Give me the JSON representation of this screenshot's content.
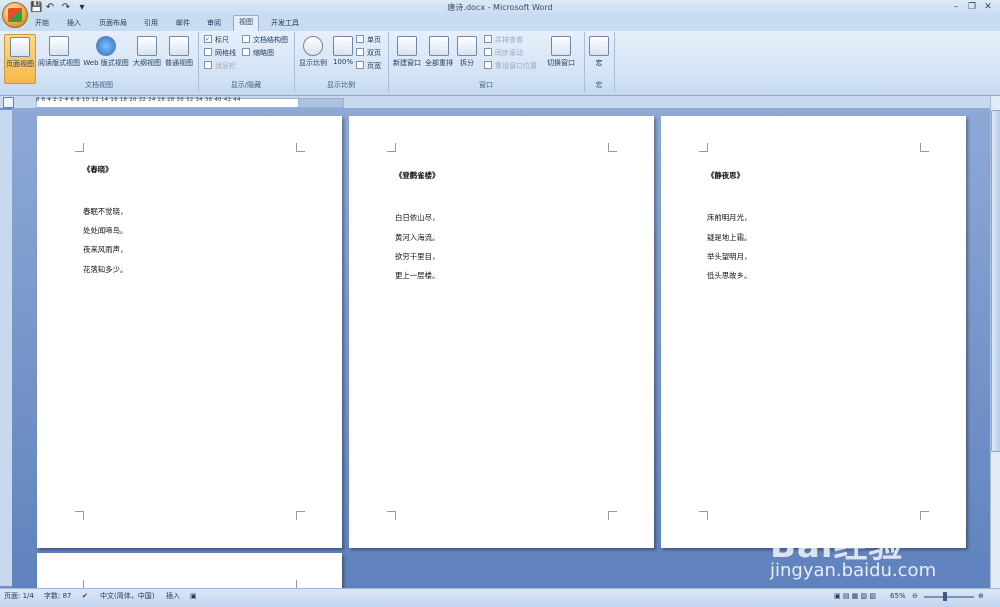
{
  "window": {
    "title": "唐诗.docx - Microsoft Word"
  },
  "tabs": [
    "开始",
    "插入",
    "页面布局",
    "引用",
    "邮件",
    "审阅",
    "视图",
    "开发工具"
  ],
  "active_tab": "视图",
  "ribbon": {
    "doc_views": {
      "label": "文档视图",
      "buttons": [
        "页面视图",
        "阅读版式视图",
        "Web 版式视图",
        "大纲视图",
        "普通视图"
      ],
      "selected": "页面视图"
    },
    "show_hide": {
      "label": "显示/隐藏",
      "ruler": "标尺",
      "gridlines": "网格线",
      "message_bar": "消息栏",
      "doc_map": "文档结构图",
      "thumbnails": "缩略图"
    },
    "zoom": {
      "label": "显示比例",
      "zoom_btn": "显示比例",
      "hundred": "100%",
      "one_page": "单页",
      "two_pages": "双页",
      "page_width": "页宽"
    },
    "window": {
      "label": "窗口",
      "new_window": "新建窗口",
      "arrange_all": "全部重排",
      "split": "拆分",
      "side_by_side": "并排查看",
      "sync_scroll": "同步滚动",
      "reset_position": "重设窗口位置",
      "switch_windows": "切换窗口"
    },
    "macros": {
      "label": "宏",
      "btn": "宏"
    }
  },
  "ruler_ticks": "8   6   4   2       2   4   6   8   10   12   14   16   18   20   22   24   26   28   30   32   34   36       40   42   44",
  "pages": [
    {
      "title": "《春晓》",
      "lines": [
        "春眠不觉晓，",
        "处处闻啼鸟。",
        " 夜来风雨声，",
        "花落知多少。"
      ]
    },
    {
      "title": "《登鹳雀楼》",
      "lines": [
        "白日依山尽，",
        "黄河入海流。",
        "欲穷千里目，",
        "更上一层楼。"
      ]
    },
    {
      "title": "《静夜思》",
      "lines": [
        "床前明月光，",
        "疑是地上霜。",
        "举头望明月，",
        "低头思故乡。"
      ]
    }
  ],
  "status": {
    "page": "页面: 1/4",
    "words": "字数: 87",
    "language": "中文(简体，中国)",
    "mode": "插入",
    "zoom": "65%"
  },
  "watermark": {
    "brand": "Bai经验",
    "url": "jingyan.baidu.com"
  }
}
